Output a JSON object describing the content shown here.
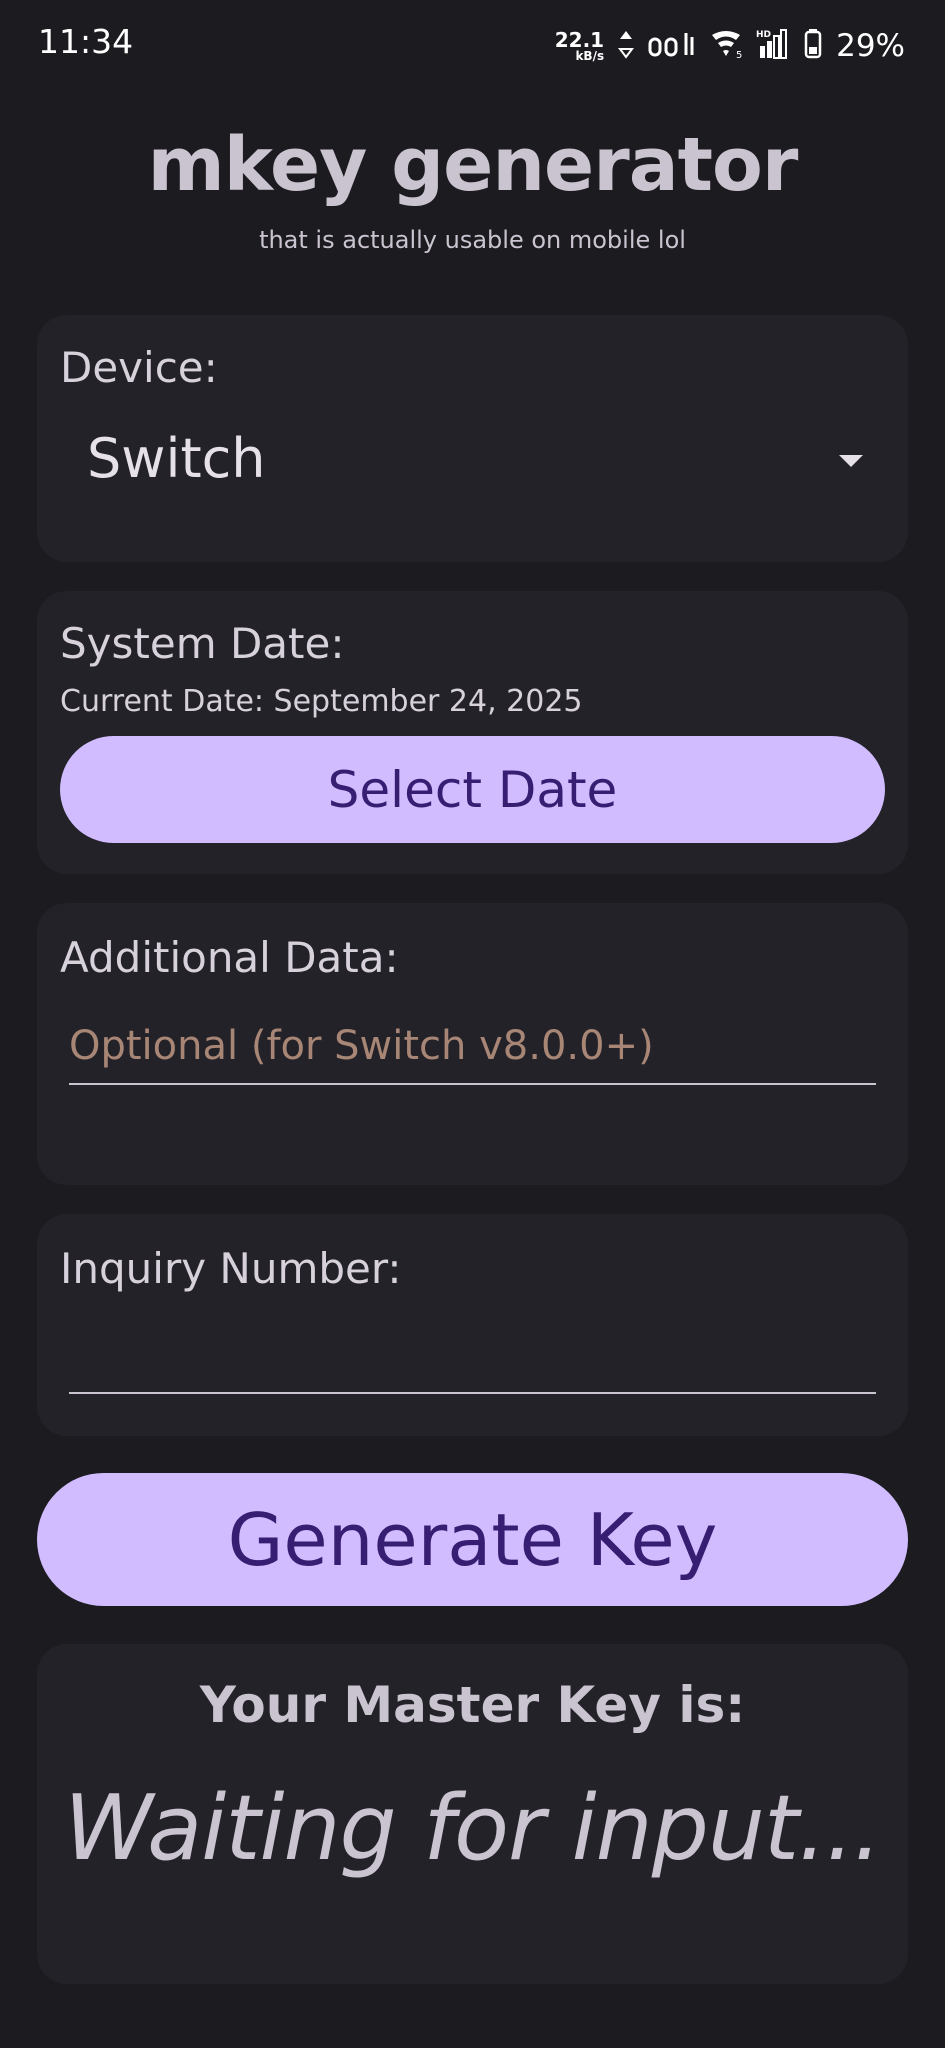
{
  "status_bar": {
    "time": "11:34",
    "net_speed": "22.1",
    "net_unit": "kB/s",
    "hd_label": "HD",
    "battery": "29%"
  },
  "header": {
    "title": "mkey generator",
    "subtitle": "that is actually usable on mobile lol"
  },
  "device": {
    "label": "Device:",
    "selected": "Switch"
  },
  "system_date": {
    "label": "System Date:",
    "current": "Current Date: September 24, 2025",
    "button_label": "Select Date"
  },
  "additional_data": {
    "label": "Additional Data:",
    "placeholder": "Optional (for Switch v8.0.0+)",
    "value": ""
  },
  "inquiry": {
    "label": "Inquiry Number:",
    "value": ""
  },
  "generate": {
    "button_label": "Generate Key"
  },
  "result": {
    "title": "Your Master Key is:",
    "value": "Waiting for input..."
  },
  "colors": {
    "background": "#1c1b1f",
    "card": "#232228",
    "primary_button": "#d0bcff",
    "primary_button_text": "#381e72",
    "placeholder": "#a88676"
  },
  "icons": {
    "dropdown": "arrow-drop-down-icon",
    "wifi": "wifi-icon",
    "signal": "signal-icon",
    "battery": "battery-icon"
  }
}
